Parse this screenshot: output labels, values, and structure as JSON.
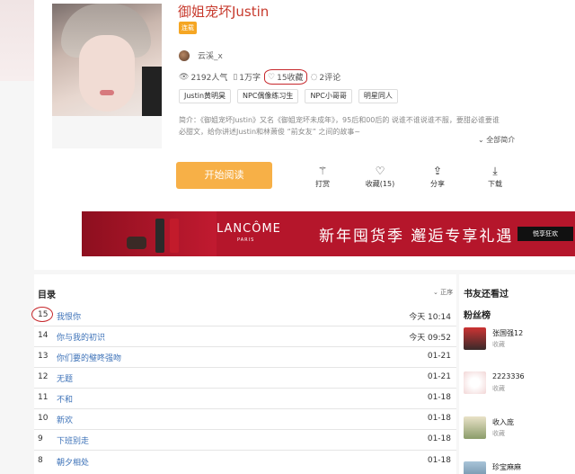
{
  "book": {
    "title": "御姐宠坏Justin",
    "badge": "连载",
    "author": "云溪_x",
    "stats": {
      "popularity": "2192人气",
      "words": "1万字",
      "favorites": "15收藏",
      "comments": "2评论"
    },
    "tags": [
      "Justin黄明昊",
      "NPC偶像练习生",
      "NPC小哥哥",
      "明星同人"
    ],
    "intro_line1": "简介：《御姐宠坏Justin》又名《御姐宠坏未成年》，95后和00后的 说谁不谁说谁不服，要甜必谁要谁",
    "intro_line2": "必甜文，给你讲述Justin和林萧俊 “前女友” 之间的故事~",
    "expand": "全部简介"
  },
  "actions": {
    "read": "开始阅读",
    "tip": "打赏",
    "favorite": "收藏(15)",
    "share": "分享",
    "download": "下载"
  },
  "icons": {
    "views": "eye-icon",
    "words": "document-icon",
    "favorites": "heart-icon",
    "comments": "comment-icon",
    "tip": "magic-wand-icon",
    "share": "share-icon",
    "download": "download-icon"
  },
  "banner": {
    "brand": "LANCÔME",
    "brand_sub": "PARIS",
    "slogan": "新年囤货季 邂逅专享礼遇",
    "cta": "悦享狂欢"
  },
  "toc": {
    "title": "目录",
    "sort": "正序",
    "chapters": [
      {
        "num": "15",
        "name": "我恨你",
        "time": "今天 10:14"
      },
      {
        "num": "14",
        "name": "你与我的初识",
        "time": "今天 09:52"
      },
      {
        "num": "13",
        "name": "你们要的璧咚强吻",
        "time": "01-21"
      },
      {
        "num": "12",
        "name": "无题",
        "time": "01-21"
      },
      {
        "num": "11",
        "name": "不和",
        "time": "01-18"
      },
      {
        "num": "10",
        "name": "新欢",
        "time": "01-18"
      },
      {
        "num": "9",
        "name": "下班别走",
        "time": "01-18"
      },
      {
        "num": "8",
        "name": "朝夕相处",
        "time": "01-18"
      }
    ]
  },
  "sidebar": {
    "title": "书友还看过",
    "fans_title": "粉丝榜",
    "fans": [
      {
        "name": "张国强12",
        "action": "收藏",
        "color": "#3a2a2a"
      },
      {
        "name": "2223336",
        "action": "收藏",
        "color": "#f2e6e6"
      },
      {
        "name": "收入庞",
        "action": "收藏",
        "color": "#c9d9b0"
      },
      {
        "name": "珍宝麻麻",
        "action": "",
        "color": "#8fb0c9"
      }
    ]
  }
}
